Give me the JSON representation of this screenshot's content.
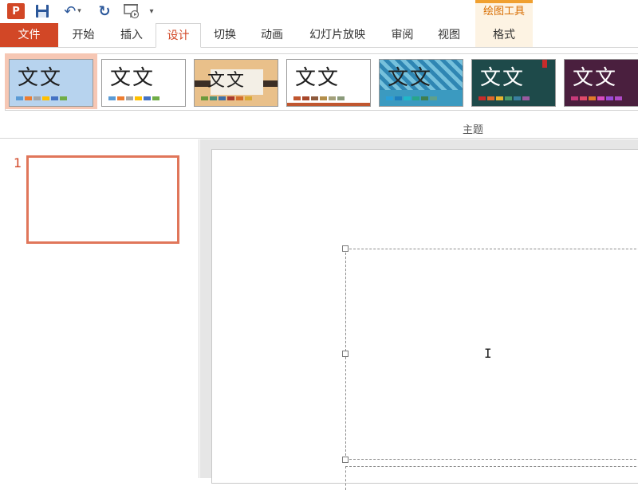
{
  "app": {
    "logo_letter": "P",
    "name": "PowerPoint"
  },
  "quick_access": {
    "undo_dropdown": "▾",
    "customize": "▾"
  },
  "context_group": {
    "title": "绘图工具"
  },
  "tabs": [
    {
      "label": "文件"
    },
    {
      "label": "开始"
    },
    {
      "label": "插入"
    },
    {
      "label": "设计"
    },
    {
      "label": "切换"
    },
    {
      "label": "动画"
    },
    {
      "label": "幻灯片放映"
    },
    {
      "label": "审阅"
    },
    {
      "label": "视图"
    },
    {
      "label": "格式"
    }
  ],
  "active_tab": "设计",
  "ribbon": {
    "group_label": "主题",
    "themes": [
      {
        "sample": "文文",
        "text_color": "#1f1f1f",
        "bg": "#b7d3ee",
        "colors": [
          "#5b9bd5",
          "#ed7d31",
          "#a5a5a5",
          "#ffc000",
          "#4472c4",
          "#70ad47"
        ]
      },
      {
        "sample": "文文",
        "text_color": "#1f1f1f",
        "bg": "#ffffff",
        "colors": [
          "#5b9bd5",
          "#ed7d31",
          "#a5a5a5",
          "#ffc000",
          "#4472c4",
          "#70ad47"
        ]
      },
      {
        "sample": "文文",
        "text_color": "#1f1f1f",
        "bg": "#e9c08a",
        "colors": [
          "#6c9a3c",
          "#4b8f7a",
          "#3e6ea6",
          "#a83a2e",
          "#d46d2a",
          "#d9a934"
        ]
      },
      {
        "sample": "文文",
        "text_color": "#1f1f1f",
        "bg": "#ffffff",
        "colors": [
          "#c0562f",
          "#a7472a",
          "#8e5a3c",
          "#b38e4a",
          "#a3a07a",
          "#8a9a7a"
        ]
      },
      {
        "sample": "文文",
        "text_color": "#1f1f1f",
        "bg": "#3b9ac0",
        "colors": [
          "#2a9fd8",
          "#1e7fbf",
          "#20b7c9",
          "#28a58a",
          "#3f7f4f",
          "#5ea08a"
        ]
      },
      {
        "sample": "文文",
        "text_color": "#ffffff",
        "bg": "#1e4a4a",
        "colors": [
          "#c72b2b",
          "#e0662a",
          "#e8b42e",
          "#4a9a6a",
          "#3a7fa0",
          "#9a5aa0"
        ]
      },
      {
        "sample": "文文",
        "text_color": "#ffffff",
        "bg": "#4a1f3e",
        "colors": [
          "#c73a7a",
          "#e04a6a",
          "#e07a2a",
          "#d84ac0",
          "#9a4ad8",
          "#b04ac8"
        ]
      }
    ]
  },
  "thumbnails": [
    {
      "number": "1"
    }
  ]
}
